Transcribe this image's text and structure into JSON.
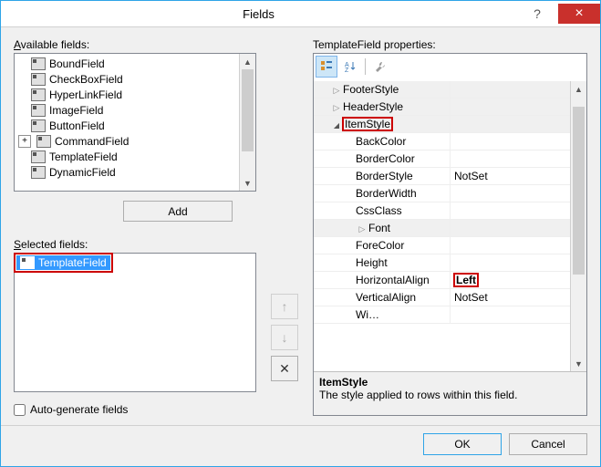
{
  "window": {
    "title": "Fields"
  },
  "labels": {
    "available": "Available fields:",
    "selected": "Selected fields:",
    "properties": "TemplateField properties:",
    "autogen": "Auto-generate fields"
  },
  "buttons": {
    "add": "Add",
    "ok": "OK",
    "cancel": "Cancel"
  },
  "availableFields": [
    {
      "name": "BoundField",
      "expander": null
    },
    {
      "name": "CheckBoxField",
      "expander": null
    },
    {
      "name": "HyperLinkField",
      "expander": null
    },
    {
      "name": "ImageField",
      "expander": null
    },
    {
      "name": "ButtonField",
      "expander": null
    },
    {
      "name": "CommandField",
      "expander": "plus"
    },
    {
      "name": "TemplateField",
      "expander": null
    },
    {
      "name": "DynamicField",
      "expander": null
    }
  ],
  "selectedFields": [
    {
      "name": "TemplateField",
      "selected": true
    }
  ],
  "autogen": false,
  "propGrid": {
    "rows": [
      {
        "type": "group",
        "state": "collapsed",
        "name": "FooterStyle",
        "indent": 1
      },
      {
        "type": "group",
        "state": "collapsed",
        "name": "HeaderStyle",
        "indent": 1
      },
      {
        "type": "group",
        "state": "expanded",
        "name": "ItemStyle",
        "indent": 1,
        "highlight": true
      },
      {
        "type": "prop",
        "name": "BackColor",
        "value": "",
        "indent": 2
      },
      {
        "type": "prop",
        "name": "BorderColor",
        "value": "",
        "indent": 2
      },
      {
        "type": "prop",
        "name": "BorderStyle",
        "value": "NotSet",
        "indent": 2
      },
      {
        "type": "prop",
        "name": "BorderWidth",
        "value": "",
        "indent": 2
      },
      {
        "type": "prop",
        "name": "CssClass",
        "value": "",
        "indent": 2
      },
      {
        "type": "group",
        "state": "collapsed",
        "name": "Font",
        "indent": 2
      },
      {
        "type": "prop",
        "name": "ForeColor",
        "value": "",
        "indent": 2
      },
      {
        "type": "prop",
        "name": "Height",
        "value": "",
        "indent": 2
      },
      {
        "type": "prop",
        "name": "HorizontalAlign",
        "value": "Left",
        "indent": 2,
        "bold": true,
        "redval": true
      },
      {
        "type": "prop",
        "name": "VerticalAlign",
        "value": "NotSet",
        "indent": 2
      },
      {
        "type": "prop",
        "name": "Width",
        "value": "",
        "indent": 2,
        "clipped": true
      }
    ],
    "desc": {
      "heading": "ItemStyle",
      "text": "The style applied to rows within this field."
    }
  }
}
